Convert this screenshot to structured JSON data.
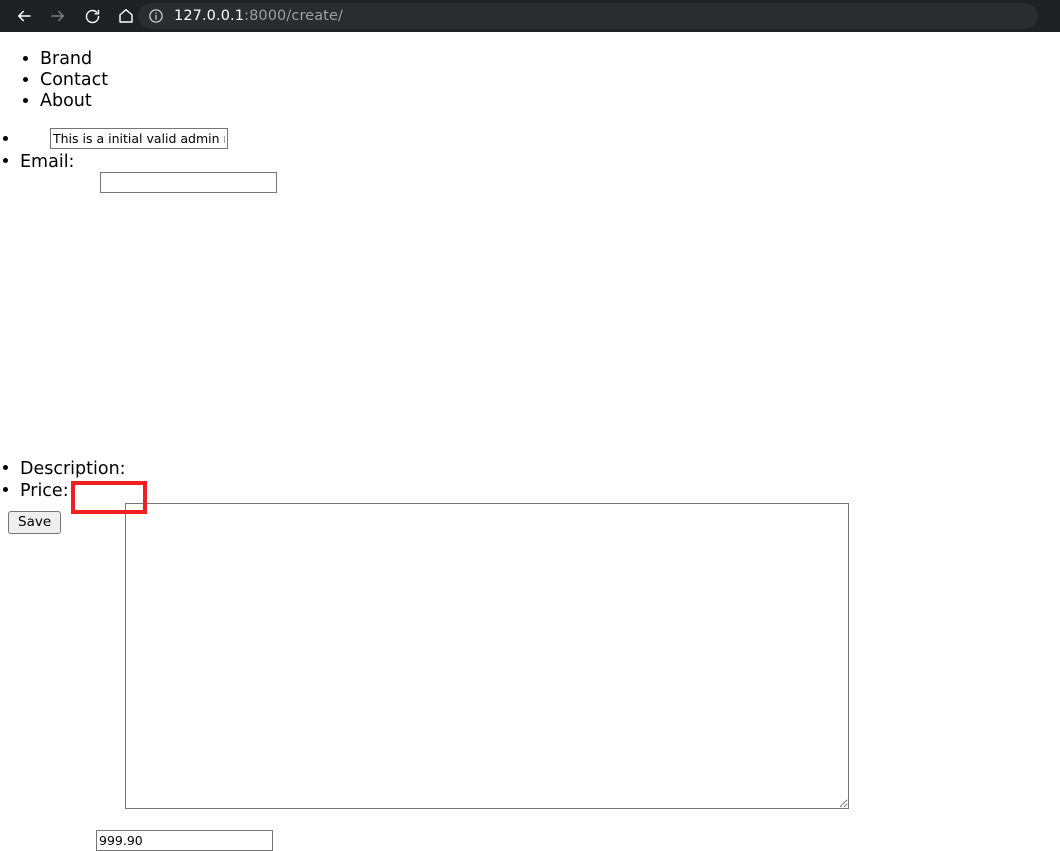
{
  "browser": {
    "back_icon": "back-arrow-icon",
    "forward_icon": "forward-arrow-icon",
    "reload_icon": "reload-icon",
    "home_icon": "home-icon",
    "site_info_icon": "info-circle-icon",
    "url_host": "127.0.0.1",
    "url_rest": ":8000/create/",
    "toolbar_bg": "#202124",
    "url_pill_bg": "#2b2c2f",
    "url_host_color": "#ffffff",
    "url_rest_color": "#9aa0a6"
  },
  "nav": {
    "items": [
      {
        "label": "Brand"
      },
      {
        "label": "Contact"
      },
      {
        "label": "About"
      }
    ]
  },
  "form": {
    "name_field": {
      "value": "This is a initial valid admin name",
      "placeholder": ""
    },
    "email_label": "Email:",
    "email_field": {
      "value": "",
      "placeholder": ""
    },
    "description_label": "Description:",
    "description_field": {
      "value": "",
      "placeholder": ""
    },
    "price_label": "Price:",
    "price_field": {
      "value": "999.90",
      "placeholder": ""
    },
    "save_button": "Save"
  },
  "annotation": {
    "highlight_color": "#f02020",
    "target": "price-input"
  }
}
